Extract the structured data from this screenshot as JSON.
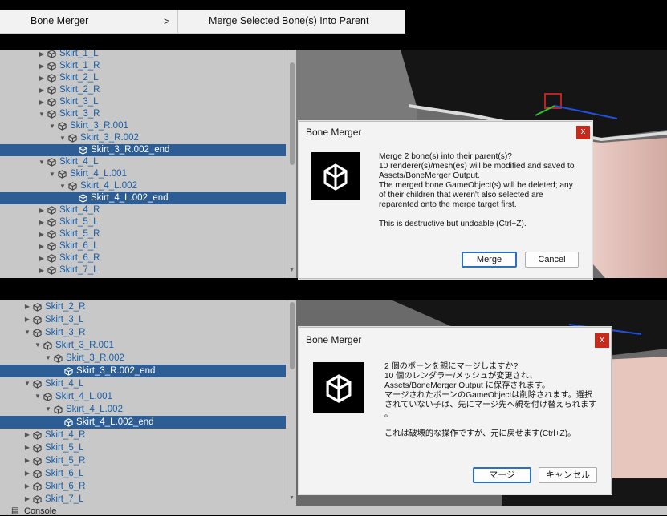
{
  "menu": {
    "parent_label": "Bone Merger",
    "submenu_arrow": ">",
    "child_label": "Merge Selected Bone(s) Into Parent"
  },
  "top": {
    "hierarchy": [
      {
        "label": "Skirt_1_L",
        "indent": 0,
        "arrow": "right",
        "selected": false
      },
      {
        "label": "Skirt_1_R",
        "indent": 0,
        "arrow": "right",
        "selected": false
      },
      {
        "label": "Skirt_2_L",
        "indent": 0,
        "arrow": "right",
        "selected": false
      },
      {
        "label": "Skirt_2_R",
        "indent": 0,
        "arrow": "right",
        "selected": false
      },
      {
        "label": "Skirt_3_L",
        "indent": 0,
        "arrow": "right",
        "selected": false
      },
      {
        "label": "Skirt_3_R",
        "indent": 0,
        "arrow": "down",
        "selected": false
      },
      {
        "label": "Skirt_3_R.001",
        "indent": 1,
        "arrow": "down",
        "selected": false
      },
      {
        "label": "Skirt_3_R.002",
        "indent": 2,
        "arrow": "down",
        "selected": false
      },
      {
        "label": "Skirt_3_R.002_end",
        "indent": 3,
        "arrow": "none",
        "selected": true
      },
      {
        "label": "Skirt_4_L",
        "indent": 0,
        "arrow": "down",
        "selected": false
      },
      {
        "label": "Skirt_4_L.001",
        "indent": 1,
        "arrow": "down",
        "selected": false
      },
      {
        "label": "Skirt_4_L.002",
        "indent": 2,
        "arrow": "down",
        "selected": false
      },
      {
        "label": "Skirt_4_L.002_end",
        "indent": 3,
        "arrow": "none",
        "selected": true
      },
      {
        "label": "Skirt_4_R",
        "indent": 0,
        "arrow": "right",
        "selected": false
      },
      {
        "label": "Skirt_5_L",
        "indent": 0,
        "arrow": "right",
        "selected": false
      },
      {
        "label": "Skirt_5_R",
        "indent": 0,
        "arrow": "right",
        "selected": false
      },
      {
        "label": "Skirt_6_L",
        "indent": 0,
        "arrow": "right",
        "selected": false
      },
      {
        "label": "Skirt_6_R",
        "indent": 0,
        "arrow": "right",
        "selected": false
      },
      {
        "label": "Skirt_7_L",
        "indent": 0,
        "arrow": "right",
        "selected": false
      }
    ],
    "dialog": {
      "title": "Bone Merger",
      "close": "x",
      "lines": [
        "Merge 2 bone(s) into their parent(s)?",
        "10 renderer(s)/mesh(es) will be modified and saved to",
        "Assets/BoneMerger Output.",
        "The merged bone GameObject(s) will be deleted; any",
        "of their children that weren't also selected are",
        "reparented onto the merge target first.",
        "",
        "This is destructive but undoable (Ctrl+Z)."
      ],
      "ok": "Merge",
      "cancel": "Cancel"
    }
  },
  "bottom": {
    "hierarchy": [
      {
        "label": "Skirt_2_R",
        "indent": 0,
        "arrow": "right",
        "selected": false
      },
      {
        "label": "Skirt_3_L",
        "indent": 0,
        "arrow": "right",
        "selected": false
      },
      {
        "label": "Skirt_3_R",
        "indent": 0,
        "arrow": "down",
        "selected": false
      },
      {
        "label": "Skirt_3_R.001",
        "indent": 1,
        "arrow": "down",
        "selected": false
      },
      {
        "label": "Skirt_3_R.002",
        "indent": 2,
        "arrow": "down",
        "selected": false
      },
      {
        "label": "Skirt_3_R.002_end",
        "indent": 3,
        "arrow": "none",
        "selected": true
      },
      {
        "label": "Skirt_4_L",
        "indent": 0,
        "arrow": "down",
        "selected": false
      },
      {
        "label": "Skirt_4_L.001",
        "indent": 1,
        "arrow": "down",
        "selected": false
      },
      {
        "label": "Skirt_4_L.002",
        "indent": 2,
        "arrow": "down",
        "selected": false
      },
      {
        "label": "Skirt_4_L.002_end",
        "indent": 3,
        "arrow": "none",
        "selected": true
      },
      {
        "label": "Skirt_4_R",
        "indent": 0,
        "arrow": "right",
        "selected": false
      },
      {
        "label": "Skirt_5_L",
        "indent": 0,
        "arrow": "right",
        "selected": false
      },
      {
        "label": "Skirt_5_R",
        "indent": 0,
        "arrow": "right",
        "selected": false
      },
      {
        "label": "Skirt_6_L",
        "indent": 0,
        "arrow": "right",
        "selected": false
      },
      {
        "label": "Skirt_6_R",
        "indent": 0,
        "arrow": "right",
        "selected": false
      },
      {
        "label": "Skirt_7_L",
        "indent": 0,
        "arrow": "right",
        "selected": false
      }
    ],
    "dialog": {
      "title": "Bone Merger",
      "close": "x",
      "lines": [
        "2 個のボーンを親にマージしますか?",
        "10 個のレンダラー/メッシュが変更され、",
        "Assets/BoneMerger Output に保存されます。",
        "マージされたボーンのGameObjectは削除されます。選択",
        "されていない子は、先にマージ先へ親を付け替えられます",
        "。",
        "",
        "これは破壊的な操作ですが、元に戻せます(Ctrl+Z)。"
      ],
      "ok": "マージ",
      "cancel": "キャンセル"
    }
  },
  "console_tab": "Console",
  "colors": {
    "selection": "#2c5d94",
    "hierarchy_bg": "#c8c8c8",
    "link_text": "#1a5ea8",
    "close_button": "#c42b1c",
    "primary_border": "#2c70c4"
  }
}
